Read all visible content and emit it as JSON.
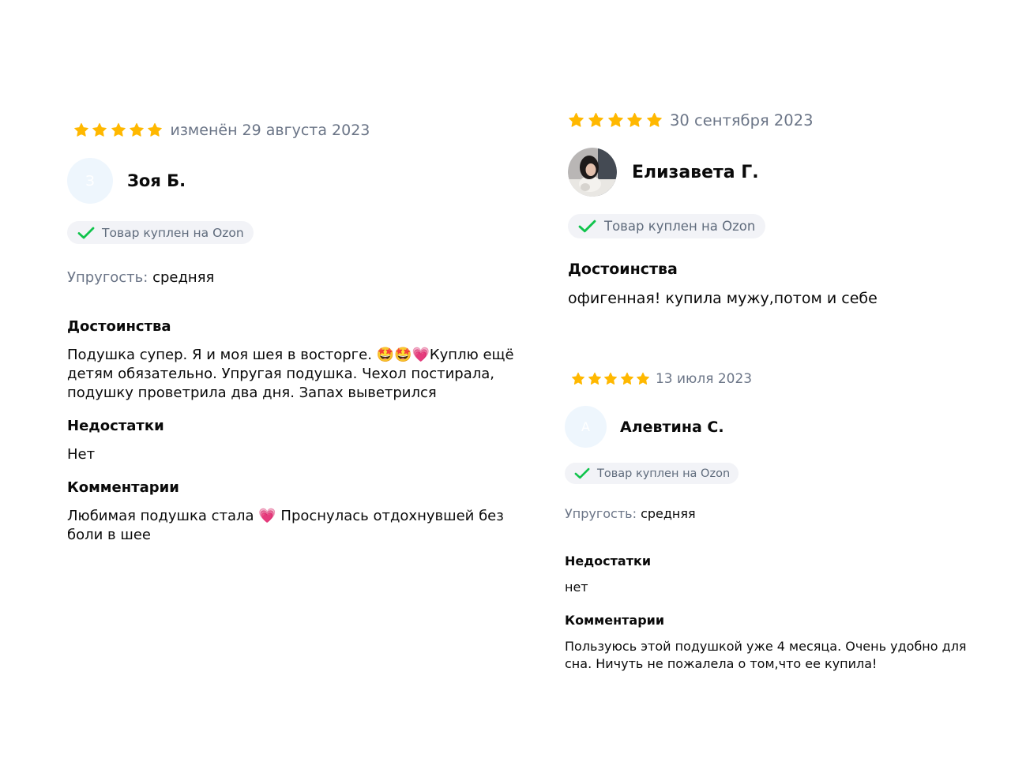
{
  "colors": {
    "star": "#ffb800",
    "check": "#10c44c",
    "badge_bg": "#f2f3f7",
    "muted_text": "#6b7587",
    "text": "#0a0a0a",
    "avatar_bg": "#eef6fd"
  },
  "icons": {
    "star": "star-icon",
    "check": "check-icon"
  },
  "reviews": [
    {
      "rating": 5,
      "date": "изменён 29 августа 2023",
      "avatar_initial": "З",
      "author": "Зоя Б.",
      "badge": "Товар куплен на Ozon",
      "param_label": "Упругость:",
      "param_value": "средняя",
      "pros_title": "Достоинства",
      "pros_text": "Подушка супер. Я и моя шея в восторге. 🤩🤩💗Куплю ещё детям обязательно. Упругая подушка. Чехол постирала, подушку проветрила два дня. Запах выветрился",
      "cons_title": "Недостатки",
      "cons_text": "Нет",
      "comment_title": "Комментарии",
      "comment_text": "Любимая подушка стала 💗 Проснулась отдохнувшей без боли в шее"
    },
    {
      "rating": 5,
      "date": "30 сентября 2023",
      "author": "Елизавета Г.",
      "badge": "Товар куплен на Ozon",
      "pros_title": "Достоинства",
      "pros_text": "офигенная! купила мужу,потом и себе"
    },
    {
      "rating": 5,
      "date": "13 июля 2023",
      "avatar_initial": "А",
      "author": "Алевтина С.",
      "badge": "Товар куплен на Ozon",
      "param_label": "Упругость:",
      "param_value": "средняя",
      "cons_title": "Недостатки",
      "cons_text": "нет",
      "comment_title": "Комментарии",
      "comment_text": "Пользуюсь этой подушкой уже 4 месяца. Очень удобно для сна. Ничуть не пожалела о том,что ее купила!"
    }
  ]
}
